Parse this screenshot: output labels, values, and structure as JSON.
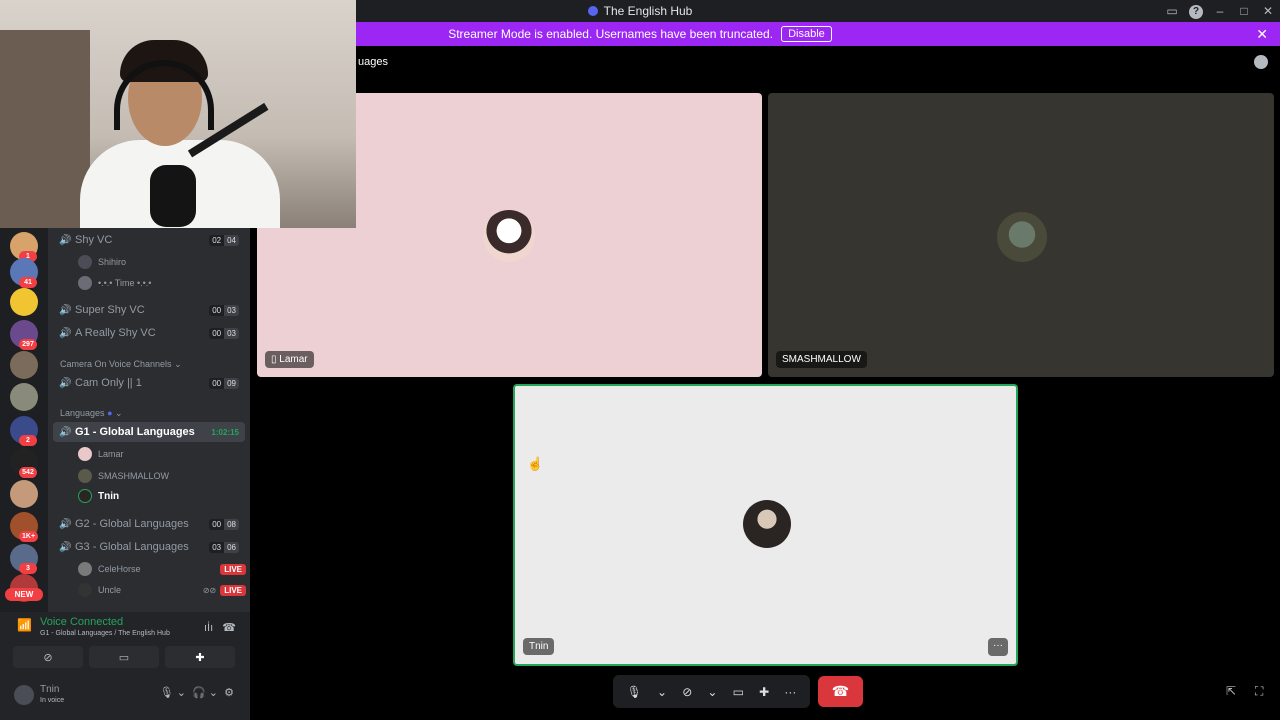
{
  "window": {
    "title": "The English Hub"
  },
  "banner": {
    "text": "Streamer Mode is enabled. Usernames have been truncated.",
    "button": "Disable"
  },
  "header": {
    "title": "uages"
  },
  "servers": [
    {
      "badge": "1",
      "color": "#d7a36a"
    },
    {
      "badge": "41",
      "color": "#5a78b8"
    },
    {
      "badge": "",
      "color": "#f0c531"
    },
    {
      "badge": "297",
      "color": "#6a4a8c"
    },
    {
      "badge": "",
      "color": "#7a6b5a"
    },
    {
      "badge": "",
      "color": "#8a8a7a"
    },
    {
      "badge": "2",
      "color": "#3a4a8a"
    },
    {
      "badge": "542",
      "color": "#222"
    },
    {
      "badge": "",
      "color": "#c49a7a"
    },
    {
      "badge": "1K+",
      "color": "#a0502a"
    },
    {
      "badge": "3",
      "color": "#5a6a8a"
    },
    {
      "badge": "",
      "color": "#b03a3a"
    }
  ],
  "rail": {
    "new_label": "NEW"
  },
  "channels": {
    "shy_vc": {
      "name": "Shy VC",
      "count_a": "02",
      "count_b": "04"
    },
    "shy_users": [
      "Shihiro",
      "•.•.• Time •.•.•"
    ],
    "super_shy": {
      "name": "Super Shy VC",
      "count_a": "00",
      "count_b": "03"
    },
    "really_shy": {
      "name": "A Really Shy VC",
      "count_a": "00",
      "count_b": "03"
    },
    "cat_camera": "Camera On Voice Channels",
    "cam_only": {
      "name": "Cam Only || 1",
      "count_a": "00",
      "count_b": "09"
    },
    "cat_languages": "Languages",
    "g1": {
      "name": "G1 - Global Languages",
      "timer": "1:02:15"
    },
    "g1_users": [
      "Lamar",
      "SMASHMALLOW",
      "Tnin"
    ],
    "g2": {
      "name": "G2 - Global Languages",
      "count_a": "00",
      "count_b": "08"
    },
    "g3": {
      "name": "G3 - Global Languages",
      "count_a": "03",
      "count_b": "06"
    },
    "g3_users": [
      {
        "name": "CeleHorse",
        "badge": "LIVE"
      },
      {
        "name": "Uncle",
        "badge": "LIVE"
      }
    ]
  },
  "voice": {
    "status": "Voice Connected",
    "channel": "G1 - Global Languages / The English Hub"
  },
  "user": {
    "name": "Tnin",
    "status": "In voice"
  },
  "tiles": [
    {
      "name": "Lamar",
      "bg": "#ecd0d3"
    },
    {
      "name": "SMASHMALLOW",
      "bg": "#37352f"
    },
    {
      "name": "Tnin",
      "bg": "#ebebeb",
      "accent": "#23a55a"
    }
  ],
  "icons": {
    "mic": "microphone-icon",
    "camera": "camera-off-icon",
    "screen": "screenshare-icon",
    "activity": "activity-icon",
    "more": "more-icon",
    "hangup": "hangup-icon"
  }
}
